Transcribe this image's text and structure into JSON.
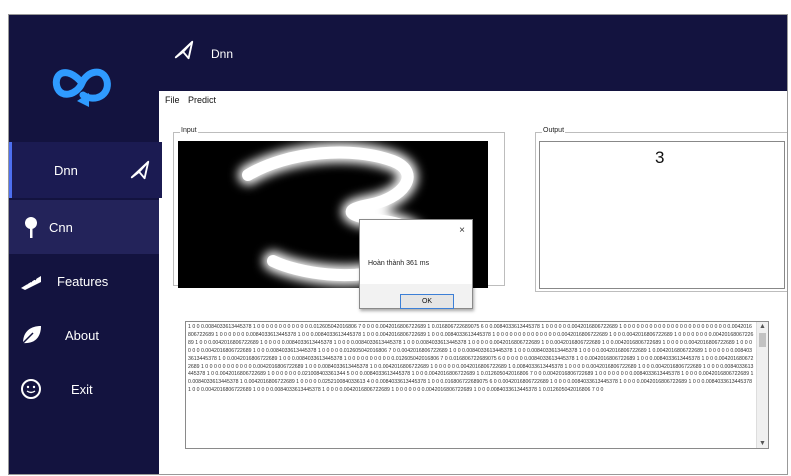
{
  "header": {
    "title": "Dnn"
  },
  "menu": {
    "file": "File",
    "predict": "Predict"
  },
  "sidebar": {
    "items": [
      {
        "label": "Dnn",
        "icon": "paper-plane-icon"
      },
      {
        "label": "Cnn",
        "icon": "map-pin-icon"
      },
      {
        "label": "Features",
        "icon": "ruler-icon"
      },
      {
        "label": "About",
        "icon": "leaf-icon"
      },
      {
        "label": "Exit",
        "icon": "smiley-icon"
      }
    ]
  },
  "input_group": {
    "label": "Input"
  },
  "output_group": {
    "label": "Output",
    "value": "3"
  },
  "dialog": {
    "message": "Hoàn thành 361  ms",
    "ok_label": "OK",
    "close_glyph": "×"
  },
  "vector_text": "1 0 0 0.0084033613445378 1 0 0 0 0 0 0 0 0 0 0 0 0 0.012605042016806 7 0 0 0 0.0042016806722689 1 0.016806722689075 6 0 0.0084033613445378 1 0 0 0 0 0 0.0042016806722689 1 0 0 0 0 0 0 0 0 0 0 0 0 0 0 0 0 0 0 0 0 0 0 0 0 0.0042016806722689 1 0 0 0 0 0 0 0.0084033613445378 1 0 0 0.0084033613445378 1 0 0 0.0042016806722689 1 0 0 0.0084033613445378 1 0 0 0 0 0 0 0 0 0 0 0 0 0 0 0.0042016806722689 1 0 0 0.0042016806722689 1 0 0 0 0 0 0 0 0.0042016806722689 1 0 0 0.0042016806722689 1 0 0 0 0 0.0084033613445378 1 0 0 0 0.0084033613445378 1 0 0 0.0084033613445378 1 0 0 0 0 0.0042016806722689 1 0 0.0042016806722689 1 0 0.0042016806722689 1 0 0 0 0 0.0042016806722689 1 0 0 0 0 0 0 0.0042016806722689 1 0 0 0.0084033613445378 1 0 0 0 0 0.012605042016806 7 0 0.0042016806722689 1 0 0 0.0084033613445378 1 0 0 0.0084033613445378 1 0 0 0 0.0042016806722689 1 0.0042016806722689 1 0 0 0 0 0 0.0084033613445378 1 0 0.0042016806722689 1 0 0 0.0084033613445378 1 0 0 0 0 0 0 0 0 0 0 0.012605042016806 7 0 0.016806722689075 6 0 0 0 0 0 0.0084033613445378 1 0 0.0042016806722689 1 0 0 0.0084033613445378 1 0 0 0.0042016806722689 1 0 0 0 0 0 0 0 0 0 0 0 0.0042016806722689 1 0 0 0.0084033613445378 1 0 0.0042016806722689 1 0 0 0 0 0 0.0042016806722689 1 0.0084033613445378 1 0 0 0 0 0.0042016806722689 1 0 0 0.0042016806722689 1 0 0 0 0.0084033613445378 1 0 0.0042016806722689 1 0 0 0 0 0 0 0.021008403361344 5 0 0 0.0084033613445378 1 0 0 0.0042016806722689 1 0.012605042016806 7 0 0 0.0042016806722689 1 0 0 0 0 0 0 0 0.0084033613445378 1 0 0 0 0.0042016806722689 1 0.0084033613445378 1 0.0042016806722689 1 0 0 0 0 0.025210084033613 4 0 0.0084033613445378 1 0 0 0.016806722689075 6 0 0.0042016806722689 1 0 0 0 0.0084033613445378 1 0 0 0 0.0042016806722689 1 0 0 0.0084033613445378 1 0 0 0.0042016806722689 1 0 0 0 0.0084033613445378 1 0 0 0 0.0042016806722689 1 0 0 0 0 0 0 0.0042016806722689 1 0 0 0.0084033613445378 1 0.012605042016806 7 0 0"
}
